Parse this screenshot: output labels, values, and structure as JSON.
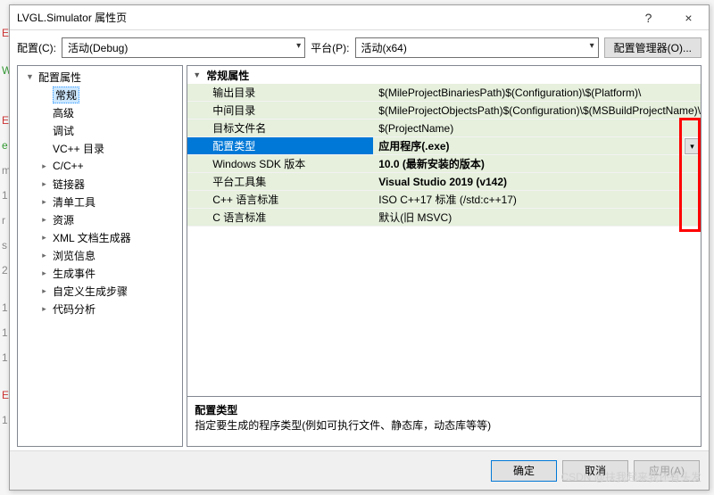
{
  "window": {
    "title": "LVGL.Simulator 属性页",
    "help": "?",
    "close": "×"
  },
  "toolbar": {
    "config_label": "配置(C):",
    "config_value": "活动(Debug)",
    "platform_label": "平台(P):",
    "platform_value": "活动(x64)",
    "config_manager": "配置管理器(O)..."
  },
  "tree": {
    "root": "配置属性",
    "children": [
      {
        "label": "常规",
        "sel": true
      },
      {
        "label": "高级"
      },
      {
        "label": "调试"
      },
      {
        "label": "VC++ 目录"
      },
      {
        "label": "C/C++",
        "expandable": true
      },
      {
        "label": "链接器",
        "expandable": true
      },
      {
        "label": "清单工具",
        "expandable": true
      },
      {
        "label": "资源",
        "expandable": true
      },
      {
        "label": "XML 文档生成器",
        "expandable": true
      },
      {
        "label": "浏览信息",
        "expandable": true
      },
      {
        "label": "生成事件",
        "expandable": true
      },
      {
        "label": "自定义生成步骤",
        "expandable": true
      },
      {
        "label": "代码分析",
        "expandable": true
      }
    ]
  },
  "grid": {
    "group": "常规属性",
    "rows": [
      {
        "name": "输出目录",
        "value": "$(MileProjectBinariesPath)$(Configuration)\\$(Platform)\\"
      },
      {
        "name": "中间目录",
        "value": "$(MileProjectObjectsPath)$(Configuration)\\$(MSBuildProjectName)\\"
      },
      {
        "name": "目标文件名",
        "value": "$(ProjectName)"
      },
      {
        "name": "配置类型",
        "value": "应用程序(.exe)",
        "sel": true,
        "bold": true,
        "dropdown": true
      },
      {
        "name": "Windows SDK 版本",
        "value": "10.0 (最新安装的版本)",
        "bold": true
      },
      {
        "name": "平台工具集",
        "value": "Visual Studio 2019 (v142)",
        "bold": true
      },
      {
        "name": "C++ 语言标准",
        "value": "ISO C++17 标准 (/std:c++17)"
      },
      {
        "name": "C 语言标准",
        "value": "默认(旧 MSVC)"
      }
    ]
  },
  "description": {
    "title": "配置类型",
    "text": "指定要生成的程序类型(例如可执行文件、静态库，动态库等等)"
  },
  "buttons": {
    "ok": "确定",
    "cancel": "取消",
    "apply": "应用(A)"
  },
  "watermark": "CSDN @扶我起来我还有头发",
  "edge": [
    "E",
    "",
    "W",
    "",
    "",
    "E",
    "e",
    "m",
    "1",
    "r",
    "s",
    "2",
    "",
    "1",
    "1",
    "1",
    "",
    "E",
    "1"
  ]
}
